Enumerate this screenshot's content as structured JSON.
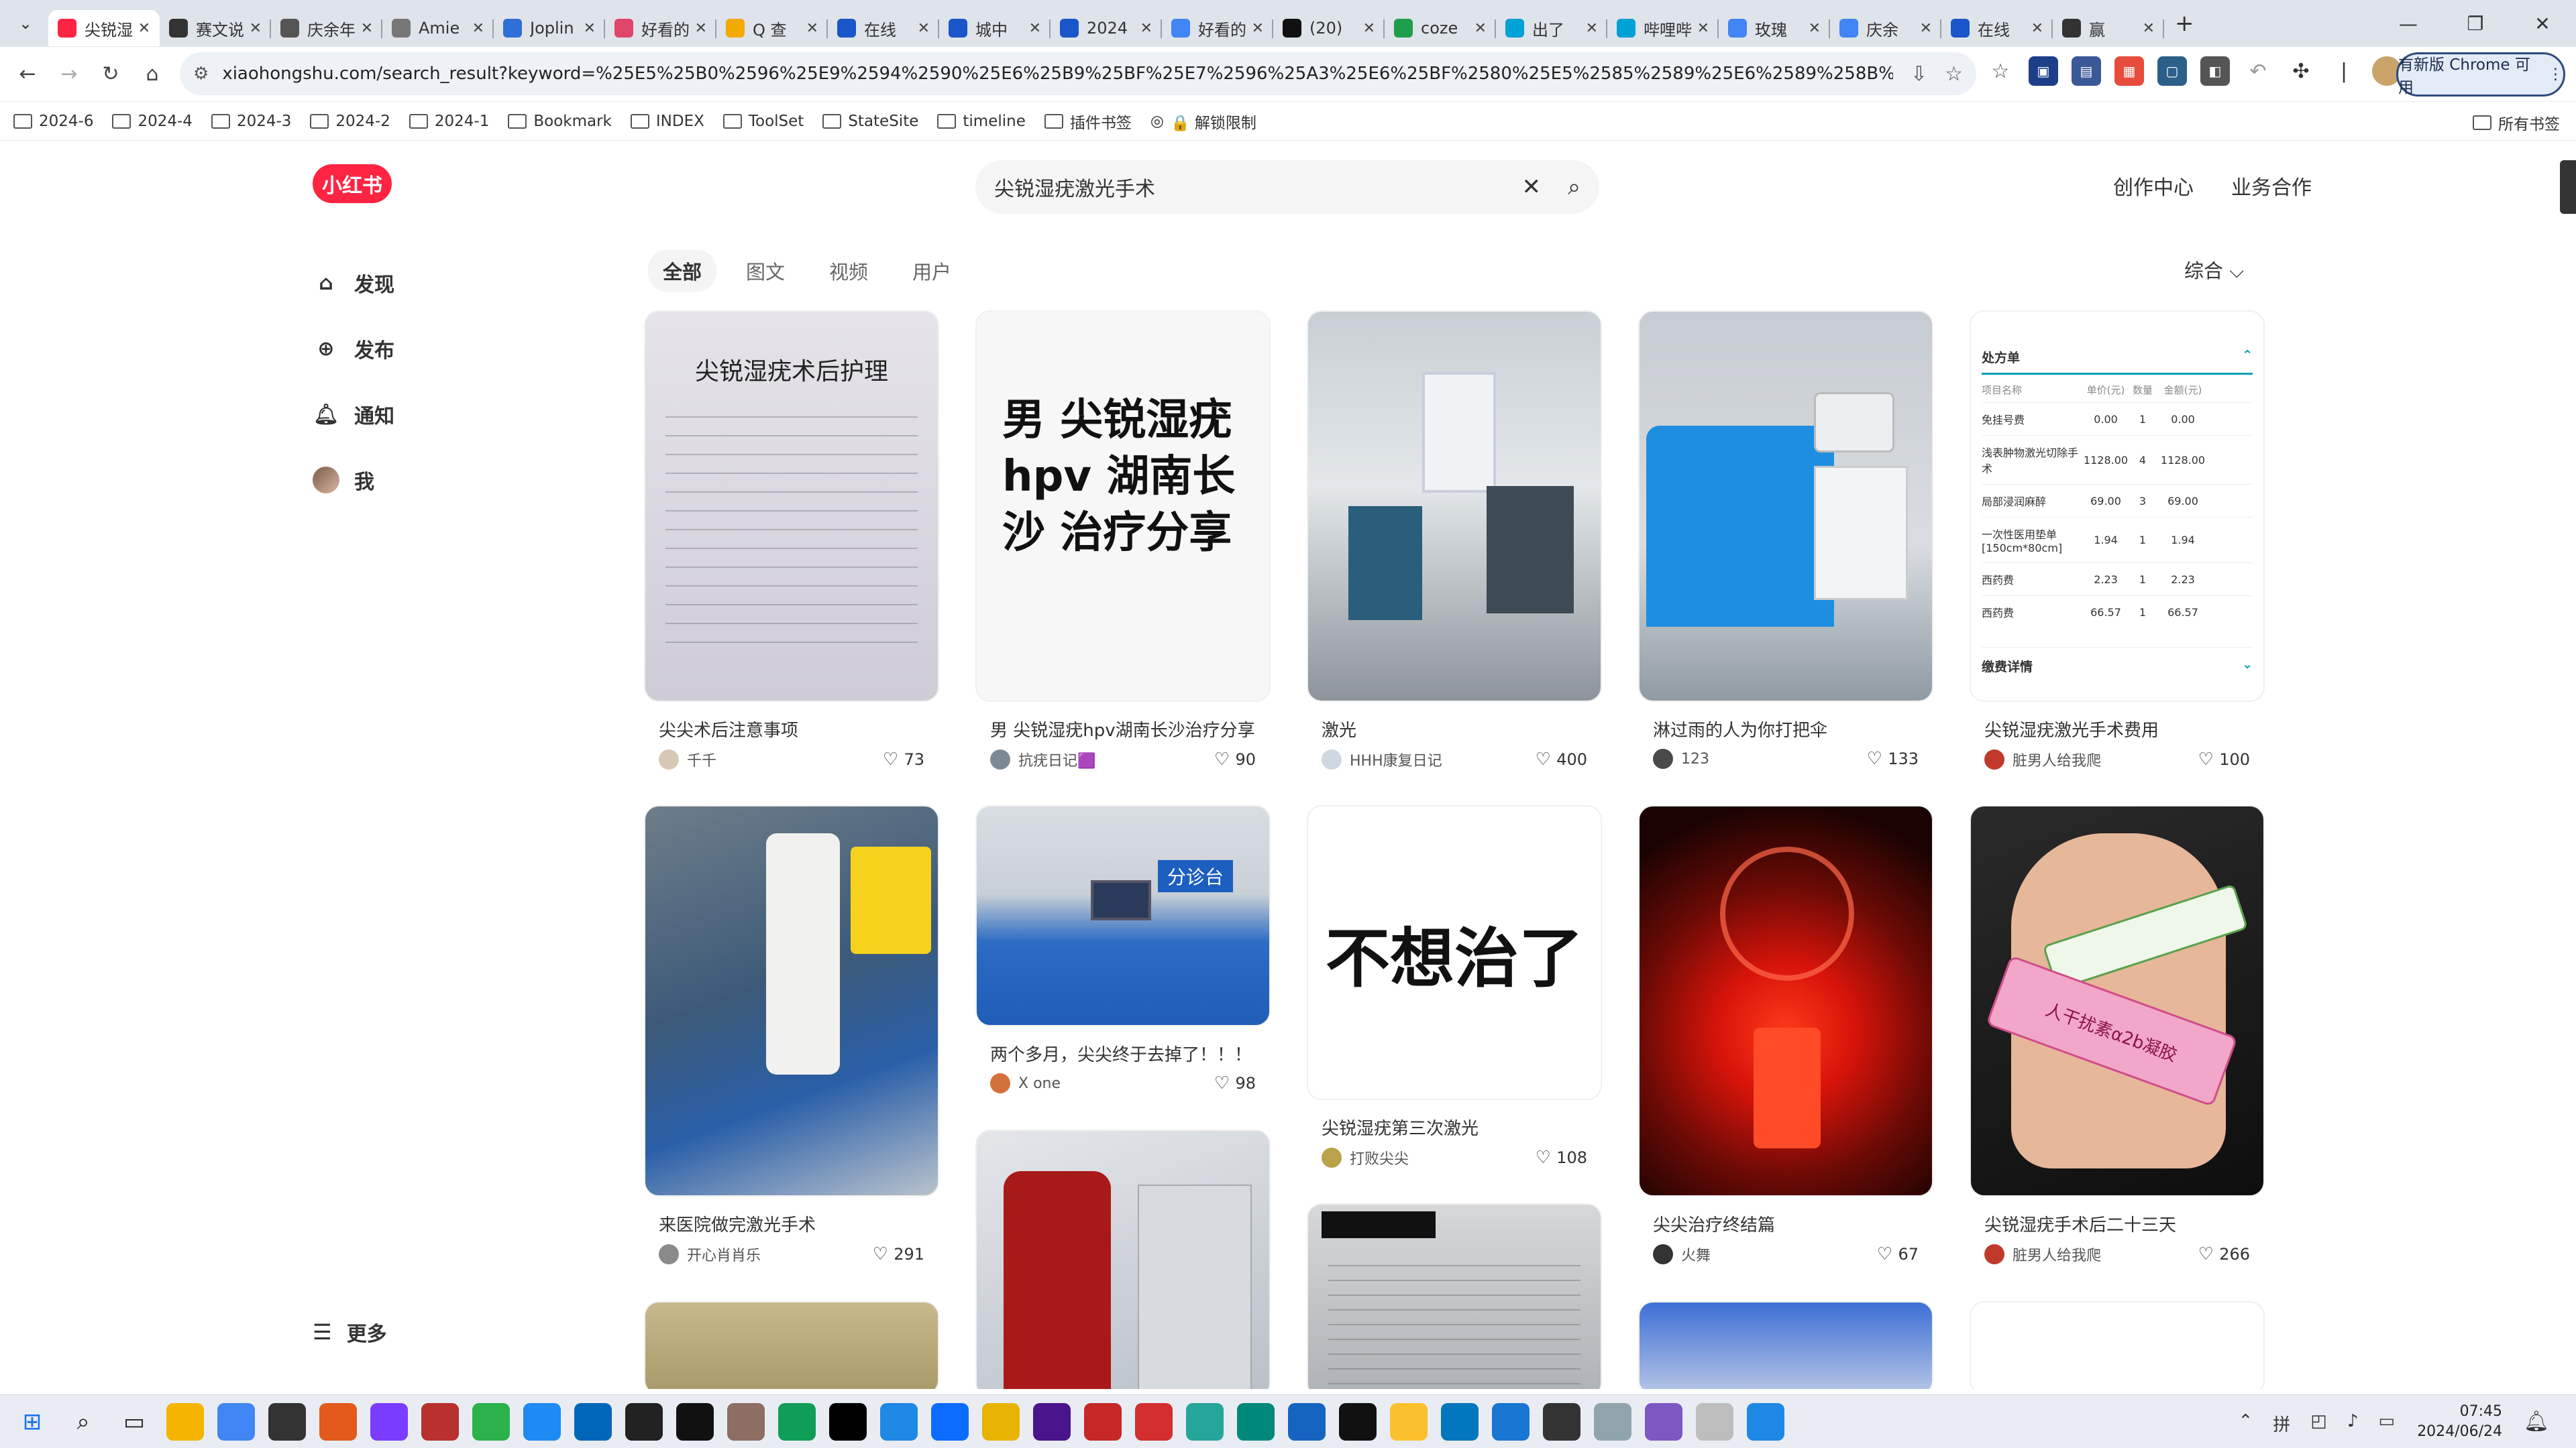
{
  "browser": {
    "tabs": [
      {
        "title": "尖锐湿",
        "color": "#ff2442",
        "active": true
      },
      {
        "title": "赛文说",
        "color": "#333333"
      },
      {
        "title": "庆余年",
        "color": "#555555"
      },
      {
        "title": "Amie",
        "color": "#777777"
      },
      {
        "title": "Joplin",
        "color": "#2f6fd6"
      },
      {
        "title": "好看的",
        "color": "#e0456b"
      },
      {
        "title": "Q 查",
        "color": "#f2a900"
      },
      {
        "title": "在线",
        "color": "#1a56c9"
      },
      {
        "title": "城中",
        "color": "#1a56c9"
      },
      {
        "title": "2024",
        "color": "#1a56c9"
      },
      {
        "title": "好看的",
        "color": "#4285f4"
      },
      {
        "title": "(20)",
        "color": "#111111"
      },
      {
        "title": "coze",
        "color": "#1e9e4a"
      },
      {
        "title": "出了",
        "color": "#00a1d6"
      },
      {
        "title": "哔哩哔",
        "color": "#00a1d6"
      },
      {
        "title": "玫瑰",
        "color": "#4285f4"
      },
      {
        "title": "庆余",
        "color": "#4285f4"
      },
      {
        "title": "在线",
        "color": "#1a56c9"
      },
      {
        "title": "赢",
        "color": "#333333"
      }
    ],
    "url": "xiaohongshu.com/search_result?keyword=%25E5%25B0%2596%25E9%2594%2590%25E6%25B9%25BF%25E7%2596%25A3%25E6%25BF%2580%25E5%2585%2589%25E6%2589%258B%25E6%259C%25AF&so...",
    "update_button": "有新版 Chrome 可用",
    "bookmarks": [
      "2024-6",
      "2024-4",
      "2024-3",
      "2024-2",
      "2024-1",
      "Bookmark",
      "INDEX",
      "ToolSet",
      "StateSite",
      "timeline",
      "插件书签",
      "🔒 解锁限制"
    ],
    "all_bookmarks": "所有书签"
  },
  "site": {
    "logo": "小红书",
    "search_query": "尖锐湿疣激光手术",
    "top_links": [
      "创作中心",
      "业务合作"
    ],
    "sidebar": [
      {
        "label": "发现",
        "icon": "discover-icon"
      },
      {
        "label": "发布",
        "icon": "publish-icon"
      },
      {
        "label": "通知",
        "icon": "bell-icon"
      },
      {
        "label": "我",
        "icon": "avatar"
      }
    ],
    "more": "更多",
    "filter_tabs": [
      "全部",
      "图文",
      "视频",
      "用户"
    ],
    "sort_label": "综合 ⌵"
  },
  "cards": [
    {
      "title": "尖尖术后注意事项",
      "author": "千千",
      "likes": "73",
      "cover_text": "尖锐湿疣术后护理",
      "avatar": "#d9c7b5"
    },
    {
      "title": "男 尖锐湿疣hpv湖南长沙治疗分享",
      "author": "抗疣日记🟪",
      "likes": "90",
      "cover_text": "男 尖锐湿疣 hpv 湖南长沙 治疗分享",
      "avatar": "#7d8a96"
    },
    {
      "title": "激光",
      "author": "HHH康复日记",
      "likes": "400",
      "avatar": "#cfd8e0"
    },
    {
      "title": "淋过雨的人为你打把伞",
      "author": "123",
      "likes": "133",
      "avatar": "#4a4a4a"
    },
    {
      "title": "尖锐湿疣激光手术费用",
      "author": "脏男人给我爬",
      "likes": "100",
      "avatar": "#c0392b"
    },
    {
      "title": "来医院做完激光手术",
      "author": "开心肖肖乐",
      "likes": "291",
      "avatar": "#8a8a8a"
    },
    {
      "title": "两个多月，尖尖终于去掉了！！！",
      "author": "X one",
      "likes": "98",
      "avatar": "#d3713a"
    },
    {
      "title": "尖锐湿疣第三次激光",
      "author": "打败尖尖",
      "likes": "108",
      "cover_text": "不想治了",
      "avatar": "#b8a24a"
    },
    {
      "title": "尖尖治疗终结篇",
      "author": "火舞",
      "likes": "67",
      "avatar": "#333333"
    },
    {
      "title": "尖锐湿疣手术后二十三天",
      "author": "脏男人给我爬",
      "likes": "266",
      "avatar": "#c0392b"
    }
  ],
  "receipt": {
    "header": "处方单",
    "cols": [
      "项目名称",
      "单价(元)",
      "数量",
      "金额(元)"
    ],
    "rows": [
      [
        "免挂号费",
        "0.00",
        "1",
        "0.00"
      ],
      [
        "浅表肿物激光切除手术",
        "1128.00",
        "4",
        "1128.00"
      ],
      [
        "局部浸润麻醉",
        "69.00",
        "3",
        "69.00"
      ],
      [
        "一次性医用垫单[150cm*80cm]",
        "1.94",
        "1",
        "1.94"
      ],
      [
        "西药费",
        "2.23",
        "1",
        "2.23"
      ],
      [
        "西药费",
        "66.57",
        "1",
        "66.57"
      ]
    ],
    "footer": "缴费详情"
  },
  "hospital_sign": "分诊台",
  "ointment_text": "人干扰素α2b凝胶",
  "taskbar": {
    "time": "07:45",
    "date": "2024/06/24"
  }
}
